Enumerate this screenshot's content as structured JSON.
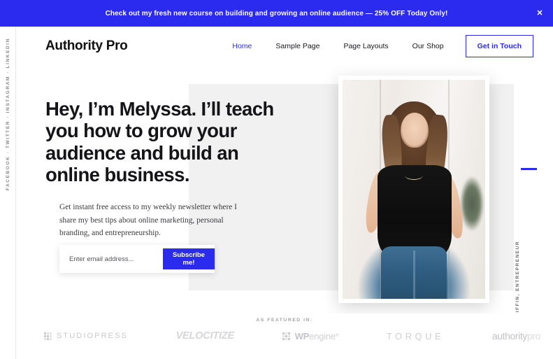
{
  "banner": {
    "message": "Check out my fresh new course on building and growing an online audience — 25% OFF Today Only!",
    "close_icon": "close-icon",
    "close_glyph": "✕",
    "background_color": "#2b2bf0"
  },
  "social_rail": {
    "text": "FACEBOOK · TWITTER · INSTAGRAM · LINKEDIN"
  },
  "header": {
    "logo": "Authority Pro",
    "nav": [
      {
        "label": "Home",
        "active": true
      },
      {
        "label": "Sample Page",
        "active": false
      },
      {
        "label": "Page Layouts",
        "active": false
      },
      {
        "label": "Our Shop",
        "active": false
      }
    ],
    "cta": "Get in Touch",
    "accent_color": "#2b2bf0"
  },
  "hero": {
    "title": "Hey, I’m Melyssa. I’ll teach you how to grow your audience and build an online business.",
    "subtitle": "Get instant free access to my weekly newsletter where I share my best tips about online marketing, personal branding, and entrepreneurship.",
    "form": {
      "email_placeholder": "Enter email address...",
      "email_value": "",
      "submit_label": "Subscribe me!"
    },
    "portrait_alt": "Portrait of Melyssa Griffin leaning against a white wall",
    "right_caption": "MELYSSA GRIFFIN, ENTREPRENEUR"
  },
  "featured": {
    "label": "AS FEATURED IN:",
    "brands": [
      {
        "name": "STUDIOPRESS"
      },
      {
        "name": "VELOCITIZE"
      },
      {
        "name_bold": "WP",
        "name_light": "engine",
        "mark": "®"
      },
      {
        "name": "TORQUE",
        "mark": "®"
      },
      {
        "name_bold": "authority",
        "name_light": "pro"
      }
    ]
  }
}
